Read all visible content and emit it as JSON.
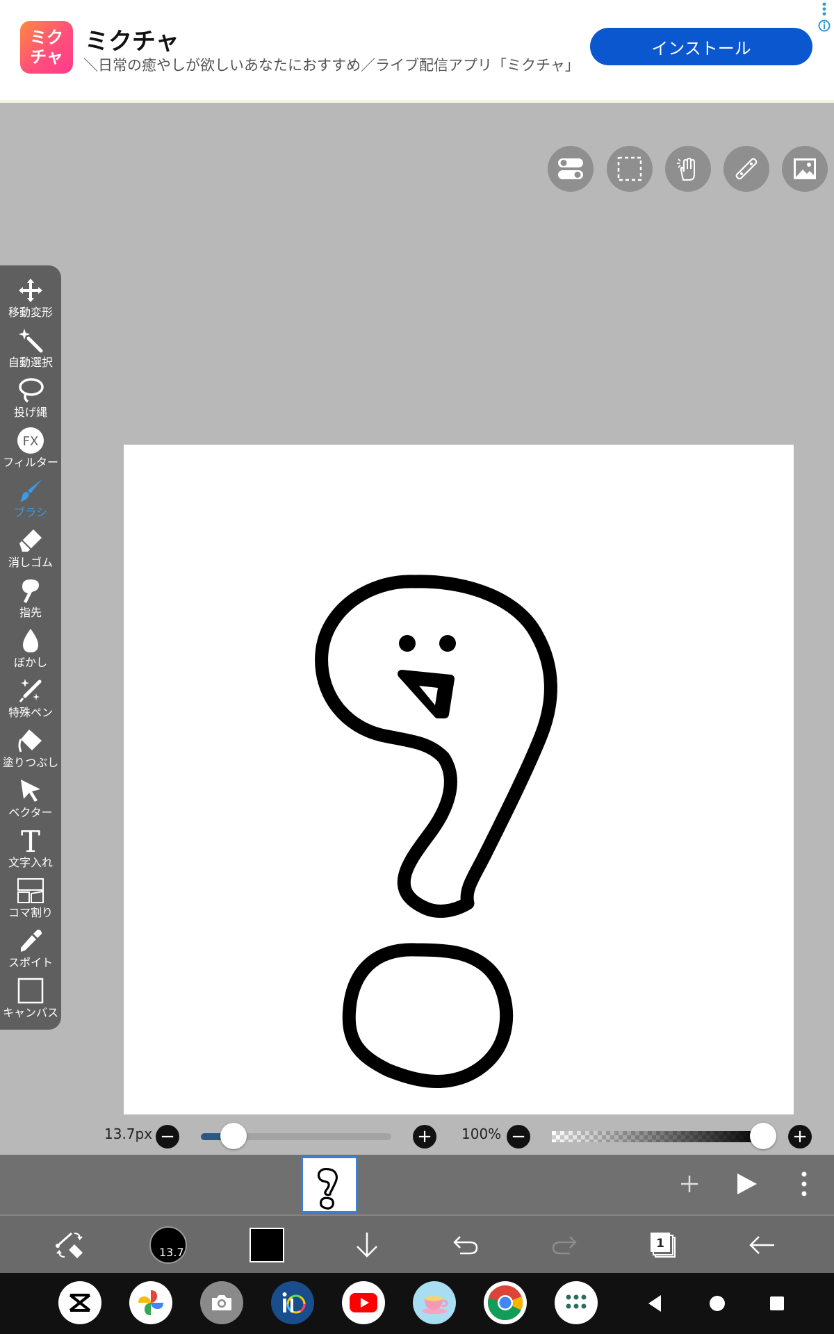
{
  "ad": {
    "logo_line1": "ミク",
    "logo_line2": "チャ",
    "title": "ミクチャ",
    "description": "＼日常の癒やしが欲しいあなたにおすすめ／ライブ配信アプリ「ミクチャ」",
    "install_label": "インストール"
  },
  "toolbar": {
    "items": [
      {
        "label": "移動変形",
        "icon": "move-icon"
      },
      {
        "label": "自動選択",
        "icon": "magic-wand-icon"
      },
      {
        "label": "投げ縄",
        "icon": "lasso-icon"
      },
      {
        "label": "フィルター",
        "icon": "fx-icon",
        "icon_text": "FX"
      },
      {
        "label": "ブラシ",
        "icon": "brush-icon",
        "active": true
      },
      {
        "label": "消しゴム",
        "icon": "eraser-icon"
      },
      {
        "label": "指先",
        "icon": "finger-icon"
      },
      {
        "label": "ぼかし",
        "icon": "blur-drop-icon"
      },
      {
        "label": "特殊ペン",
        "icon": "special-pen-icon"
      },
      {
        "label": "塗りつぶし",
        "icon": "bucket-icon"
      },
      {
        "label": "ベクター",
        "icon": "vector-icon"
      },
      {
        "label": "文字入れ",
        "icon": "text-icon",
        "icon_text": "T"
      },
      {
        "label": "コマ割り",
        "icon": "panel-icon"
      },
      {
        "label": "スポイト",
        "icon": "eyedropper-icon"
      },
      {
        "label": "キャンバス",
        "icon": "canvas-icon"
      }
    ]
  },
  "brush": {
    "size_label": "13.7px",
    "size_fraction": 0.17,
    "opacity_label": "100%",
    "opacity_fraction": 1.0,
    "minus": "−",
    "plus": "+"
  },
  "bottom": {
    "brush_size_badge": "13.7",
    "layer_count": "1",
    "current_color": "#000000"
  },
  "colors": {
    "accent": "#3b9be8",
    "install_button": "#0b57d0",
    "background": "#b8b8b8"
  }
}
